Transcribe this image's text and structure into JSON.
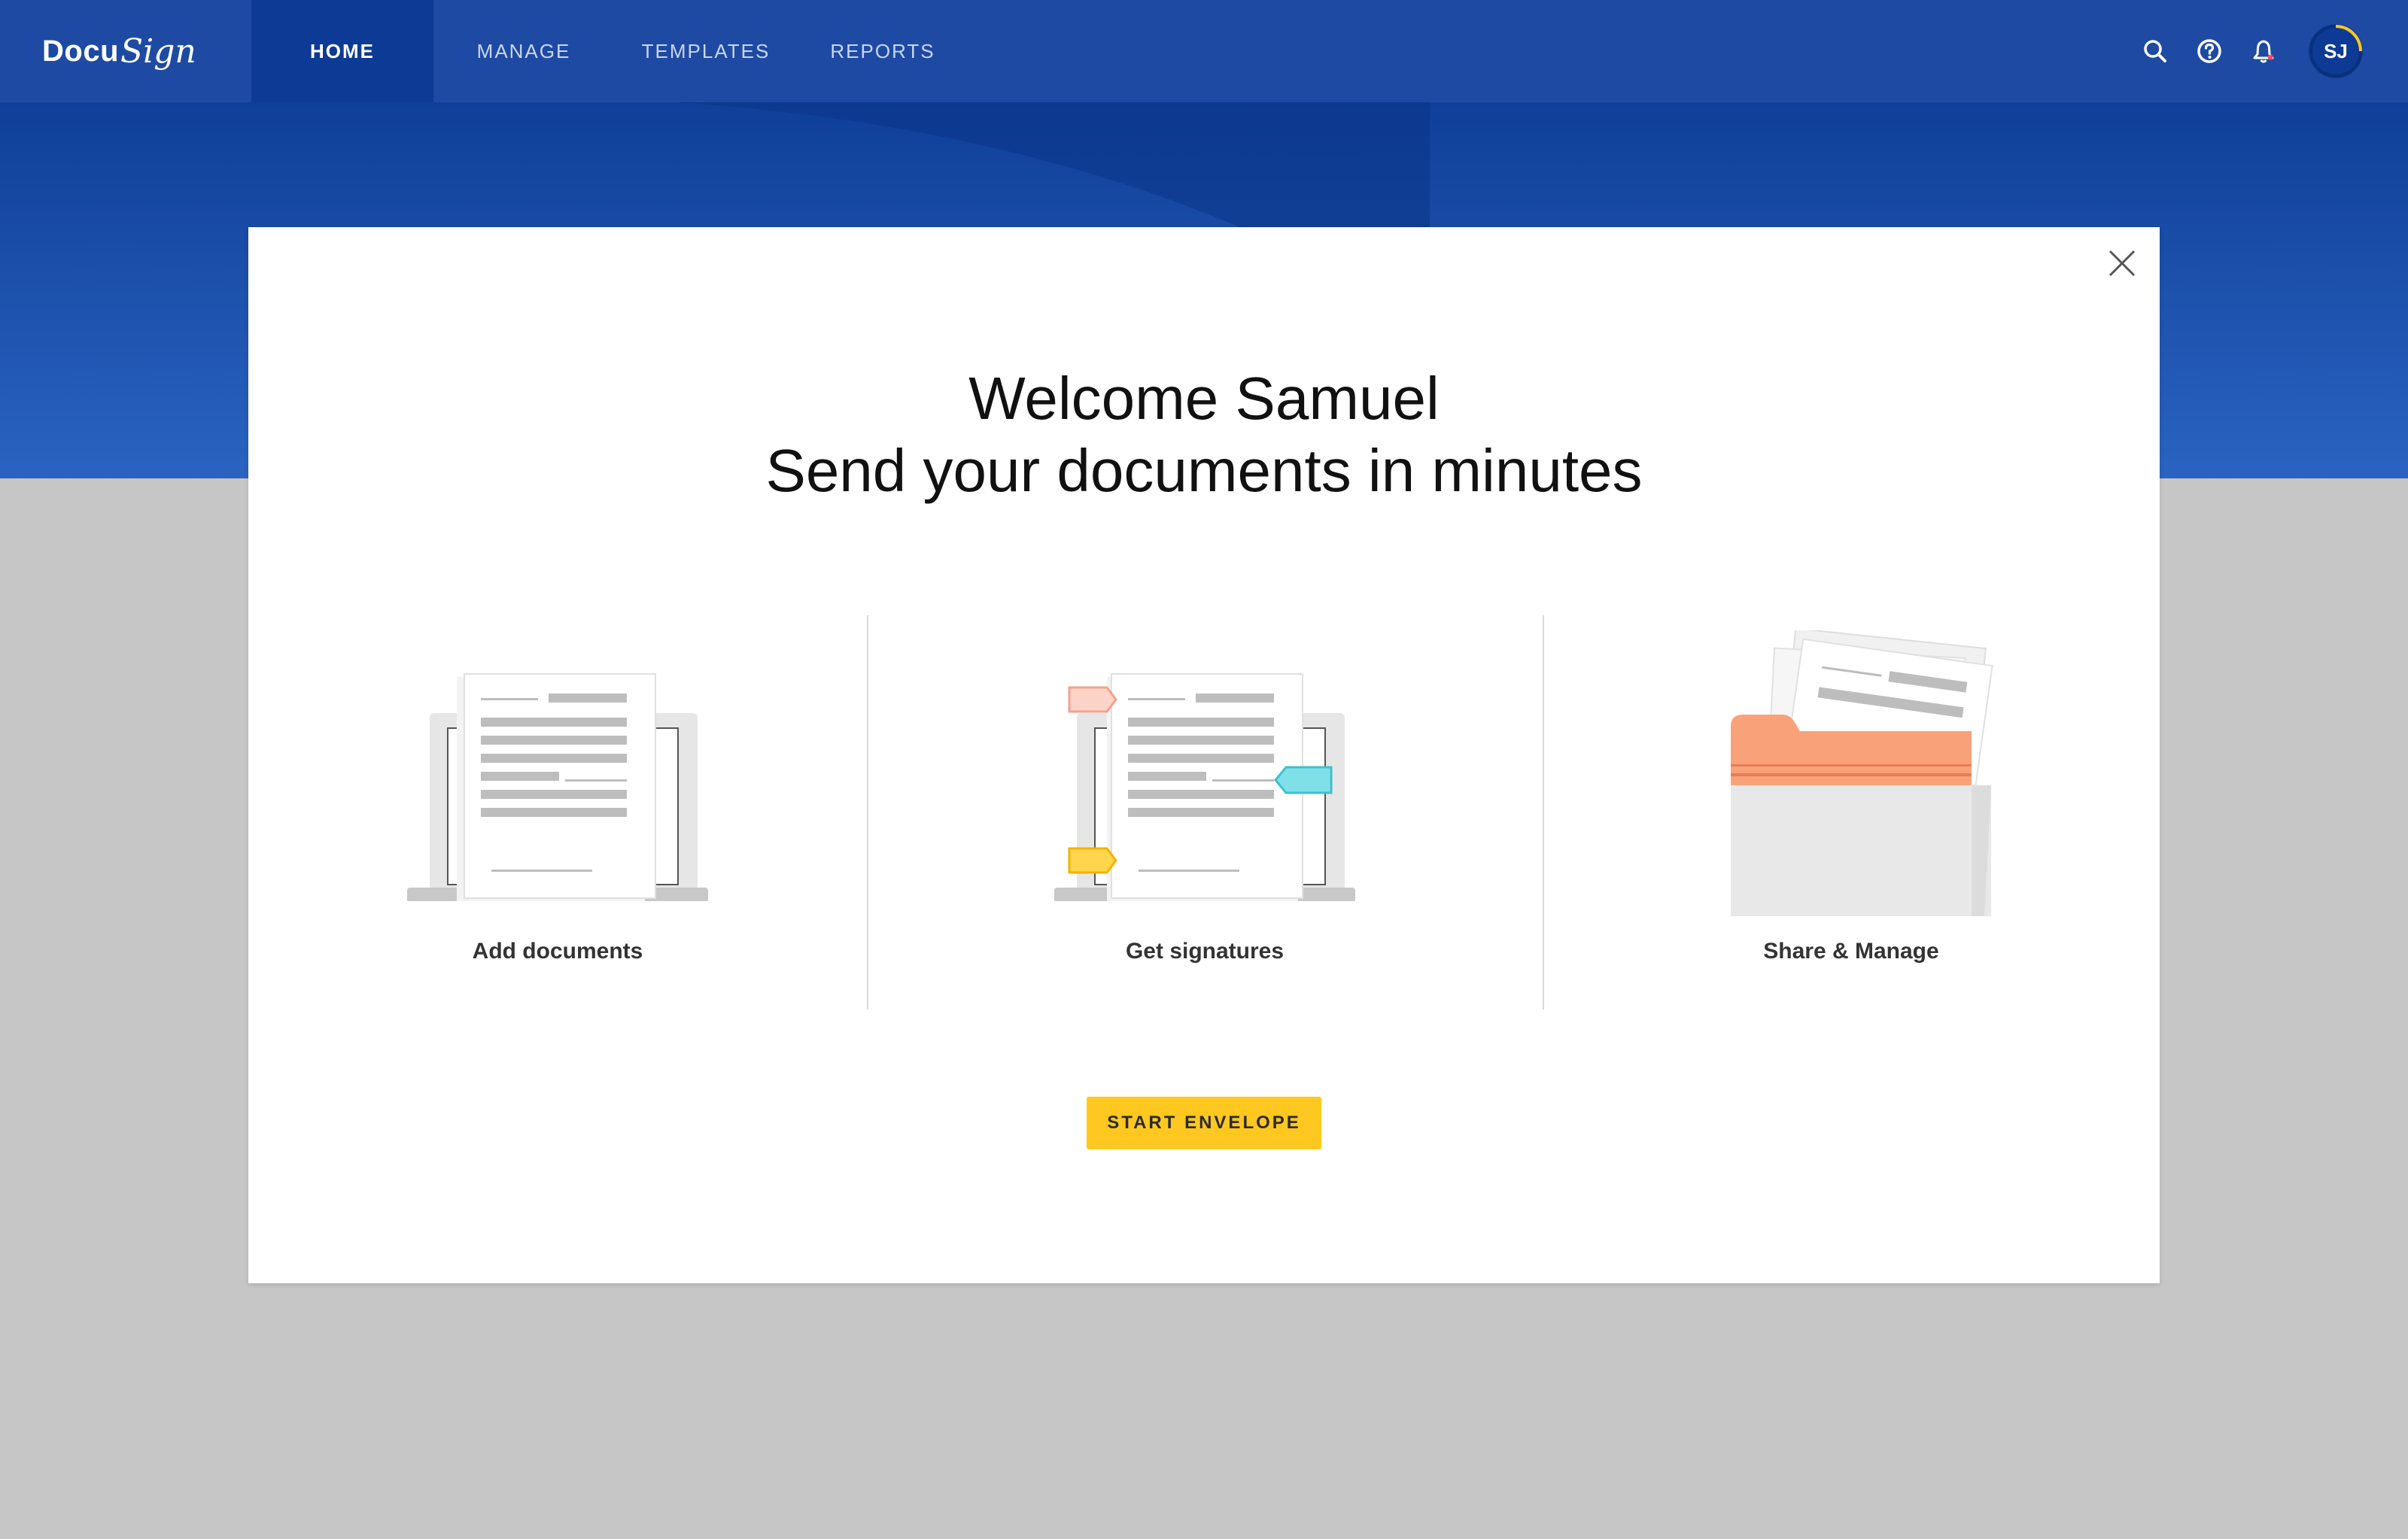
{
  "app": {
    "brand": {
      "docu": "Docu",
      "sign": "Sign"
    },
    "nav_tabs": [
      {
        "label": "HOME",
        "active": true
      },
      {
        "label": "MANAGE",
        "active": false
      },
      {
        "label": "TEMPLATES",
        "active": false
      },
      {
        "label": "REPORTS",
        "active": false
      }
    ],
    "toolbar_icons": [
      "search-icon",
      "help-icon",
      "bell-icon"
    ],
    "user": {
      "initials": "SJ"
    }
  },
  "modal": {
    "title_line1": "Welcome Samuel",
    "title_line2": "Send your documents in minutes",
    "features": [
      {
        "label": "Add documents",
        "icon": "laptop-document-illustration"
      },
      {
        "label": "Get signatures",
        "icon": "laptop-signature-tags-illustration"
      },
      {
        "label": "Share & Manage",
        "icon": "folder-documents-illustration"
      }
    ],
    "cta_label": "START ENVELOPE",
    "close_icon": "close-icon"
  },
  "colors": {
    "nav_bg": "#1e4aa3",
    "nav_active_bg": "#0d3a94",
    "cta_bg": "#ffc820",
    "folder_accent": "#f9a27a",
    "tag_red": "#f4a08e",
    "tag_cyan": "#7fe0ea",
    "tag_yellow": "#ffd64d",
    "page_bg": "#c6c6c6"
  }
}
